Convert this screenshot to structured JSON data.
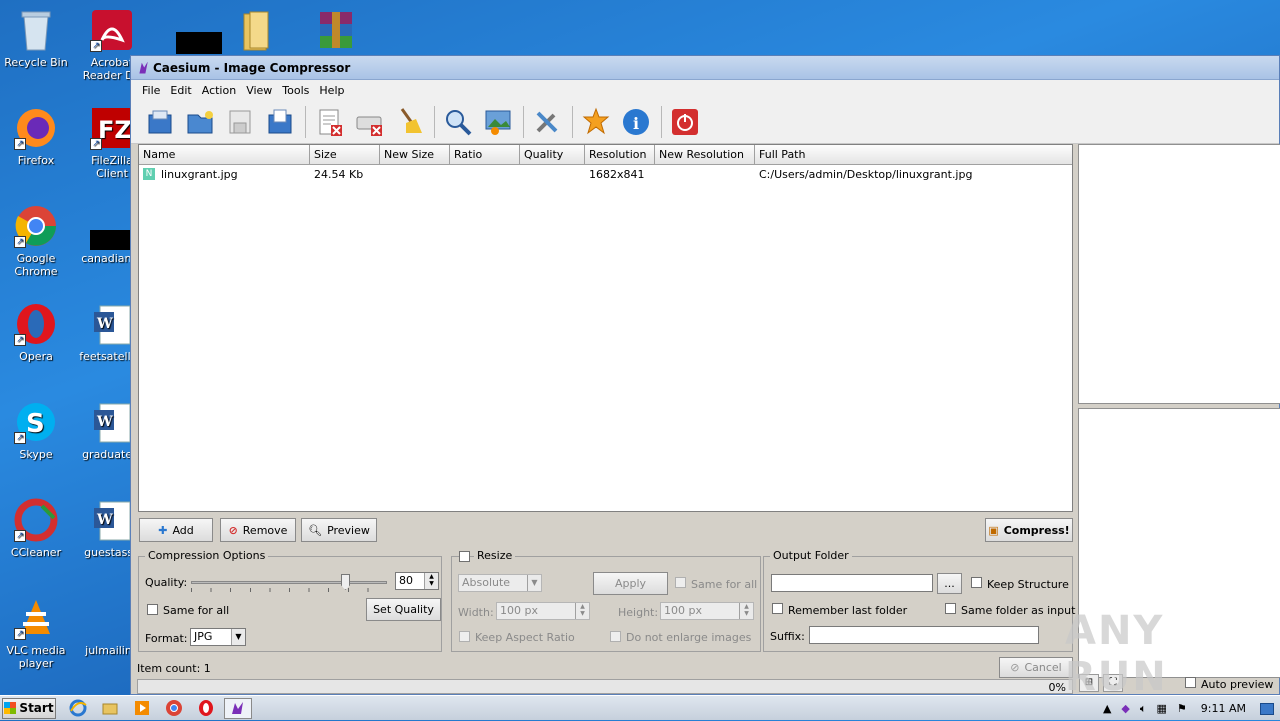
{
  "desktop": {
    "icons": [
      {
        "label": "Recycle Bin"
      },
      {
        "label": "Acrobat Reader DC"
      },
      {
        "label": "Firefox"
      },
      {
        "label": "FileZilla Client"
      },
      {
        "label": "Google Chrome"
      },
      {
        "label": "canadianar"
      },
      {
        "label": "Opera"
      },
      {
        "label": "feetsatellite"
      },
      {
        "label": "Skype"
      },
      {
        "label": "graduateel"
      },
      {
        "label": "CCleaner"
      },
      {
        "label": "guestasso"
      },
      {
        "label": "VLC media player"
      },
      {
        "label": "julmailing"
      }
    ]
  },
  "window": {
    "title": "Caesium - Image Compressor",
    "menu": [
      "File",
      "Edit",
      "Action",
      "View",
      "Tools",
      "Help"
    ]
  },
  "filelist": {
    "columns": [
      "Name",
      "Size",
      "New Size",
      "Ratio",
      "Quality",
      "Resolution",
      "New Resolution",
      "Full Path"
    ],
    "rows": [
      {
        "name": "linuxgrant.jpg",
        "size": "24.54 Kb",
        "new_size": "",
        "ratio": "",
        "quality": "",
        "resolution": "1682x841",
        "new_resolution": "",
        "full_path": "C:/Users/admin/Desktop/linuxgrant.jpg"
      }
    ]
  },
  "buttons": {
    "add": "Add",
    "remove": "Remove",
    "preview": "Preview",
    "compress": "Compress!",
    "cancel": "Cancel"
  },
  "compression": {
    "title": "Compression Options",
    "quality_label": "Quality:",
    "quality_value": "80",
    "quality_level": 80,
    "same_for_all": "Same for all",
    "set_quality": "Set Quality",
    "format_label": "Format:",
    "format_value": "JPG"
  },
  "resize": {
    "title": "Resize",
    "mode": "Absolute",
    "apply": "Apply",
    "same_for_all": "Same for all",
    "width_label": "Width:",
    "width_value": "100 px",
    "height_label": "Height:",
    "height_value": "100 px",
    "keep_aspect": "Keep Aspect Ratio",
    "no_enlarge": "Do not enlarge images"
  },
  "output": {
    "title": "Output Folder",
    "browse": "...",
    "keep_structure": "Keep Structure",
    "remember": "Remember last folder",
    "same_folder": "Same folder as input",
    "suffix_label": "Suffix:"
  },
  "status": {
    "item_count": "Item count: 1",
    "progress": "0%",
    "progress_level": 0,
    "auto_preview": "Auto preview"
  },
  "taskbar": {
    "start": "Start",
    "time": "9:11 AM"
  },
  "watermark": "ANY RUN"
}
